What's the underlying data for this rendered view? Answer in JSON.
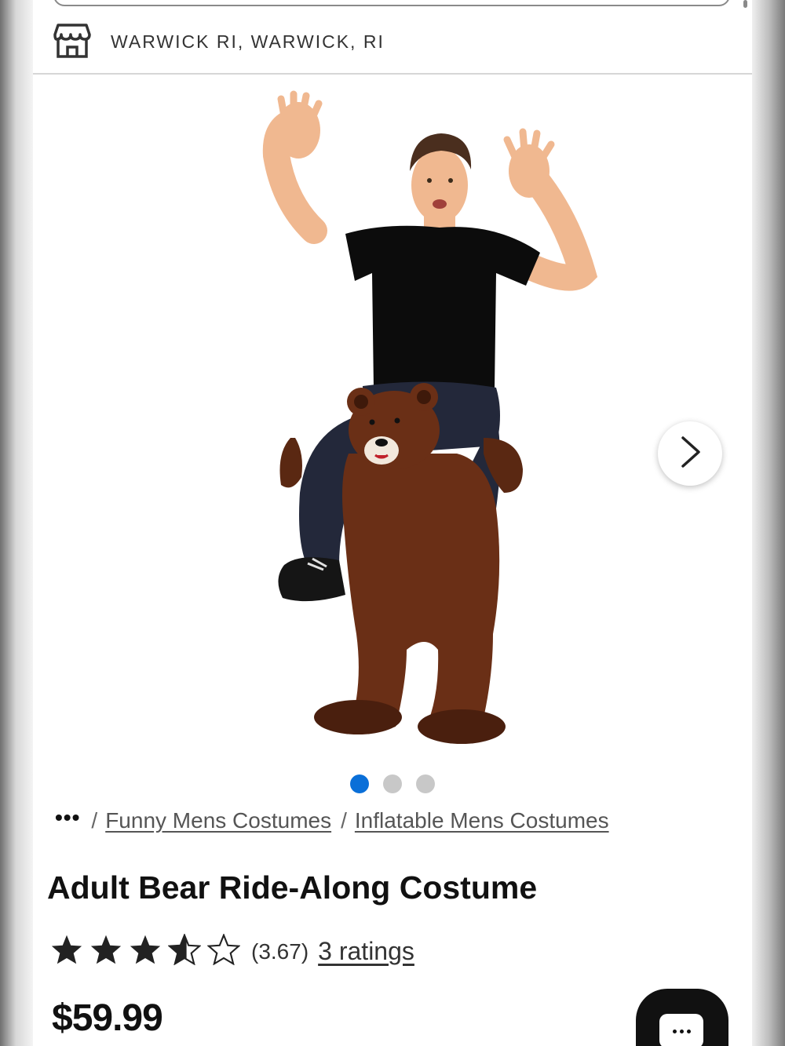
{
  "store": {
    "location_label": "WARWICK RI, WARWICK, RI",
    "icon": "store-icon"
  },
  "product_image": {
    "alt": "Adult Bear Ride-Along Costume",
    "next_icon": "chevron-right-icon",
    "slide_count": 3,
    "active_slide": 1
  },
  "breadcrumb": {
    "ellipsis": "•••",
    "separator": "/",
    "items": [
      {
        "label": "Funny Mens Costumes"
      },
      {
        "label": "Inflatable Mens Costumes"
      }
    ]
  },
  "product": {
    "title": "Adult Bear Ride-Along Costume",
    "rating": 3.67,
    "rating_display": "(3.67)",
    "ratings_link": "3 ratings",
    "max_stars": 5,
    "price": "$59.99"
  },
  "chat": {
    "icon": "chat-icon"
  },
  "colors": {
    "active_dot": "#0a6fd8",
    "inactive_dot": "#c8c8c8",
    "text_primary": "#111111",
    "chat_button": "#111111"
  }
}
